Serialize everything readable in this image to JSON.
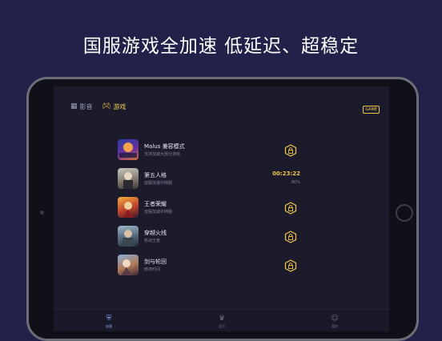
{
  "headline": "国服游戏全加速  低延迟、超稳定",
  "topbar": {
    "tabs": [
      {
        "icon": "grid-icon",
        "label": "影音"
      },
      {
        "icon": "gamepad-icon",
        "label": "游戏"
      }
    ],
    "badge": "GAME"
  },
  "games": [
    {
      "title": "Malus 兼容模式",
      "subtitle": "支持加速大部分游戏",
      "thumb_text": "兼容模式",
      "status": "lock"
    },
    {
      "title": "第五人格",
      "subtitle": "亚服加速中转服",
      "timer": "00:23:22",
      "percent": "80%",
      "status": "running"
    },
    {
      "title": "王者荣耀",
      "subtitle": "亚服加速中转服",
      "status": "lock"
    },
    {
      "title": "穿越火线",
      "subtitle": "枪战王者",
      "status": "lock"
    },
    {
      "title": "剑与轮回",
      "subtitle": "暗夜时间",
      "status": "lock"
    }
  ],
  "tabbar": [
    {
      "icon": "shield-icon",
      "label": "加速"
    },
    {
      "icon": "crown-icon",
      "label": "会员"
    },
    {
      "icon": "user-icon",
      "label": "我的"
    }
  ],
  "colors": {
    "accent": "#f0c64a",
    "background": "#22214a",
    "screen": "#1c1b2c"
  }
}
